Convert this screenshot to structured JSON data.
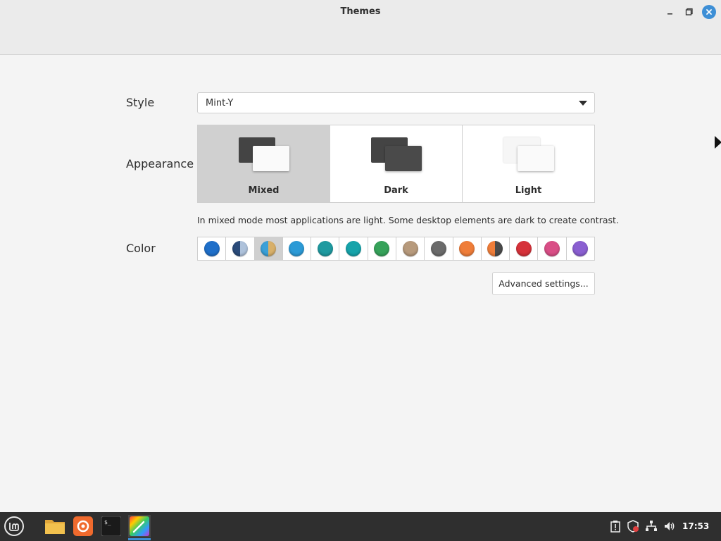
{
  "window": {
    "title": "Themes"
  },
  "style": {
    "label": "Style",
    "selected": "Mint-Y"
  },
  "appearance": {
    "label": "Appearance",
    "options": [
      {
        "label": "Mixed",
        "selected": true
      },
      {
        "label": "Dark",
        "selected": false
      },
      {
        "label": "Light",
        "selected": false
      }
    ],
    "description": "In mixed mode most applications are light. Some desktop elements are dark to create contrast."
  },
  "color": {
    "label": "Color",
    "swatches": [
      "#1f6fc9",
      "#3c5a85",
      "#3aa0d8",
      "#2c9ad6",
      "#1f9aa0",
      "#16a3aa",
      "#36a25a",
      "#b79a7c",
      "#6b6b6b",
      "#ef7d39",
      "#ef7d39",
      "#d6323a",
      "#d94e86",
      "#8a5fd1"
    ],
    "selected_index": 2
  },
  "advanced_button": "Advanced settings...",
  "taskbar": {
    "apps": [
      "menu-icon",
      "files-icon",
      "software-manager-icon",
      "terminal-icon",
      "themes-icon"
    ],
    "clock": "17:53"
  },
  "colors": {
    "accent": "#3d8fd6",
    "taskbar_bg": "#2f2f2f",
    "selected_bg": "#d0d0d0"
  }
}
